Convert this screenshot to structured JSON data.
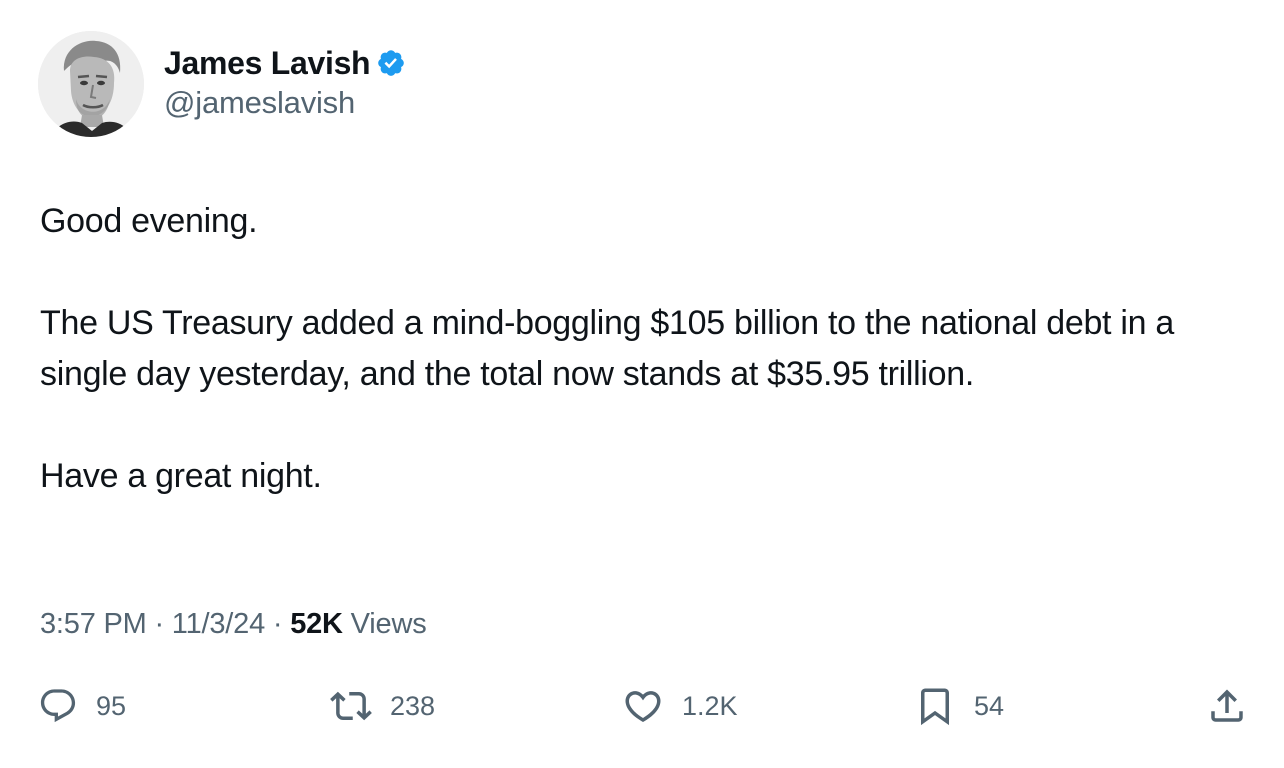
{
  "author": {
    "display_name": "James Lavish",
    "handle": "@jameslavish",
    "verified_color": "#1d9bf0",
    "avatar_icon": "user-avatar-photo"
  },
  "tweet": {
    "paragraphs": [
      "Good evening.",
      "The US Treasury added a mind-boggling $105 billion to the national debt in a single day yesterday, and the total now stands at $35.95 trillion.",
      "Have a great night."
    ]
  },
  "meta": {
    "time": "3:57 PM",
    "separator": "·",
    "date": "11/3/24",
    "views_count": "52K",
    "views_label": "Views"
  },
  "actions": {
    "replies": "95",
    "reposts": "238",
    "likes": "1.2K",
    "bookmarks": "54"
  },
  "icons": {
    "reply": "reply-icon",
    "repost": "repost-icon",
    "like": "heart-icon",
    "bookmark": "bookmark-icon",
    "share": "share-icon"
  },
  "colors": {
    "text": "#0f1419",
    "secondary": "#536471"
  }
}
